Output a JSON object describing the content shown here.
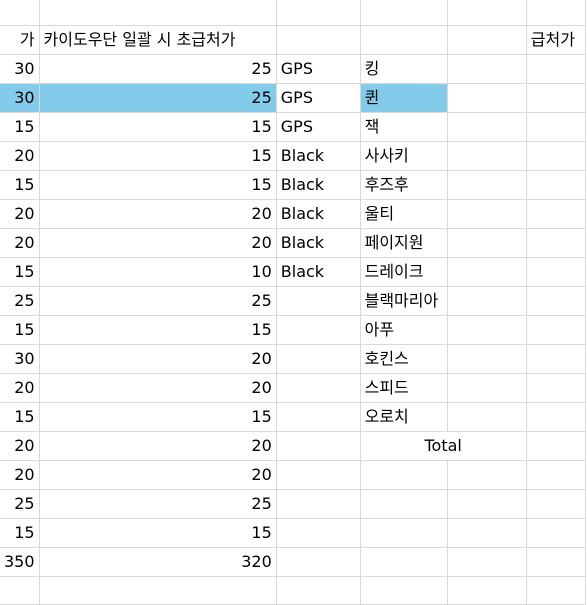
{
  "sheet": {
    "headers": {
      "col_a_partial": "가",
      "col_b": "카이도우단 일괄 시 초급처가",
      "col_f_partial": "급처가"
    },
    "left_rows": [
      {
        "a": "30",
        "b": "25"
      },
      {
        "a": "30",
        "b": "25",
        "selected": true
      },
      {
        "a": "15",
        "b": "15"
      },
      {
        "a": "20",
        "b": "15"
      },
      {
        "a": "15",
        "b": "15"
      },
      {
        "a": "20",
        "b": "20"
      },
      {
        "a": "20",
        "b": "20"
      },
      {
        "a": "15",
        "b": "10"
      },
      {
        "a": "25",
        "b": "25"
      },
      {
        "a": "15",
        "b": "15"
      },
      {
        "a": "30",
        "b": "20"
      },
      {
        "a": "20",
        "b": "20"
      },
      {
        "a": "15",
        "b": "15"
      },
      {
        "a": "20",
        "b": "20"
      },
      {
        "a": "20",
        "b": "20"
      },
      {
        "a": "25",
        "b": "25"
      },
      {
        "a": "15",
        "b": "15"
      },
      {
        "a": "350",
        "b": "320"
      }
    ],
    "right_rows": [
      {
        "c": "GPS",
        "d": "킹"
      },
      {
        "c": "GPS",
        "d": "퀸",
        "selected": true
      },
      {
        "c": "GPS",
        "d": "잭"
      },
      {
        "c": "Black",
        "d": "사사키"
      },
      {
        "c": "Black",
        "d": "후즈후"
      },
      {
        "c": "Black",
        "d": "울티"
      },
      {
        "c": "Black",
        "d": "페이지원"
      },
      {
        "c": "Black",
        "d": "드레이크"
      },
      {
        "c": "",
        "d": "블랙마리아"
      },
      {
        "c": "",
        "d": "아푸"
      },
      {
        "c": "",
        "d": "호킨스"
      },
      {
        "c": "",
        "d": "스피드"
      },
      {
        "c": "",
        "d": "오로치"
      }
    ],
    "total_label": "Total",
    "selection_color": "#82cbea",
    "gridline_color": "#d9d9d9"
  }
}
